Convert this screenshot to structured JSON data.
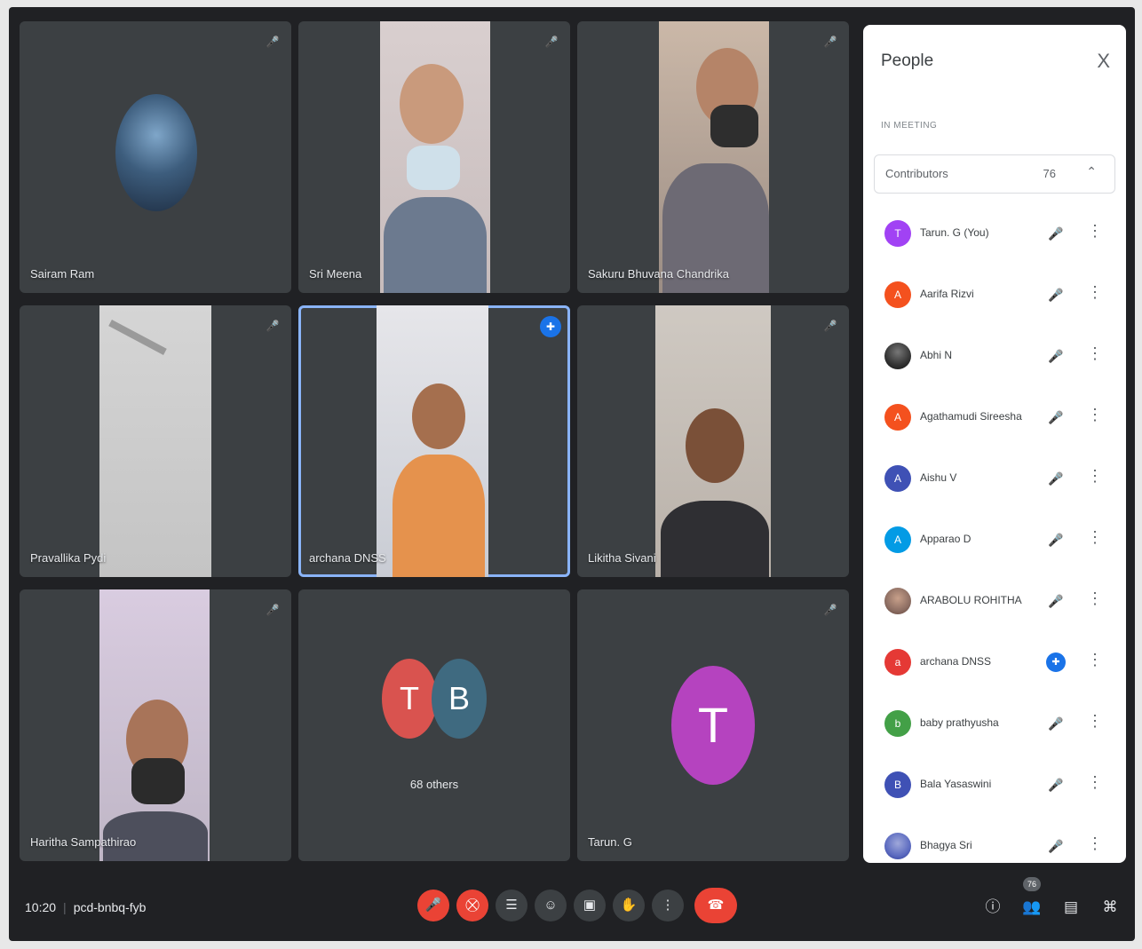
{
  "tiles": [
    {
      "name": "Sairam Ram"
    },
    {
      "name": "Sri Meena"
    },
    {
      "name": "Sakuru Bhuvana Chandrika"
    },
    {
      "name": "Pravallika Pydi"
    },
    {
      "name": "archana DNSS"
    },
    {
      "name": "Likitha Sivani"
    },
    {
      "name": "Haritha Sampathirao"
    },
    {
      "name": "",
      "avatars": [
        "T",
        "B"
      ],
      "others_label": "68 others"
    },
    {
      "name": "Tarun. G",
      "avatar": "T"
    }
  ],
  "panel": {
    "title": "People",
    "close": "X",
    "section": "IN MEETING",
    "contributors_label": "Contributors",
    "contributors_count": "76",
    "people": [
      {
        "initial": "T",
        "name": "Tarun. G (You)",
        "color": "#a142f4"
      },
      {
        "initial": "A",
        "name": "Aarifa Rizvi",
        "color": "#f4511e"
      },
      {
        "initial": "",
        "name": "Abhi N",
        "color": "#3c4043"
      },
      {
        "initial": "A",
        "name": "Agathamudi Sireesha",
        "color": "#f4511e"
      },
      {
        "initial": "A",
        "name": "Aishu V",
        "color": "#3f51b5"
      },
      {
        "initial": "A",
        "name": "Apparao D",
        "color": "#039be5"
      },
      {
        "initial": "",
        "name": "ARABOLU ROHITHA",
        "color": "#8d6e63"
      },
      {
        "initial": "a",
        "name": "archana DNSS",
        "color": "#e53935"
      },
      {
        "initial": "b",
        "name": "baby prathyusha",
        "color": "#43a047"
      },
      {
        "initial": "B",
        "name": "Bala Yasaswini",
        "color": "#3f51b5"
      },
      {
        "initial": "",
        "name": "Bhagya Sri",
        "color": "#5c6bc0"
      }
    ]
  },
  "bottom": {
    "time": "10:20",
    "code": "pcd-bnbq-fyb",
    "people_badge": "76"
  },
  "icons": {
    "mic_off": "🎤",
    "cam_off": "⛒",
    "more": "⋮"
  }
}
